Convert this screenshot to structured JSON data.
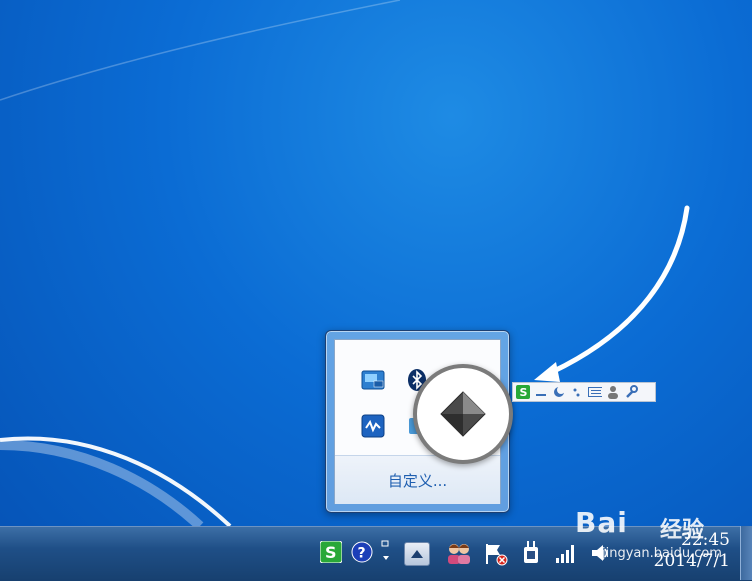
{
  "flyout": {
    "customize_label": "自定义...",
    "icons": [
      "intel-graphics-icon",
      "bluetooth-icon",
      "pink-app-icon",
      "network-app-icon",
      "blue-app-icon"
    ]
  },
  "magnifier": {
    "icon": "gray-diamond-app-icon"
  },
  "ime_toolbar": {
    "icons": [
      "sogou-s-icon",
      "fullwidth-icon",
      "moon-icon",
      "punctuation-icon",
      "keyboard-icon",
      "user-icon",
      "wrench-icon"
    ]
  },
  "taskbar": {
    "tray_icons": [
      "sogou-s-icon",
      "help-icon",
      "ime-mode-icon",
      "show-hidden-icons-button",
      "people-icon",
      "action-center-flag-icon",
      "power-plug-icon",
      "signal-bars-icon",
      "speaker-icon"
    ],
    "clock": {
      "time": "22:45",
      "date": "2014/7/1"
    }
  },
  "watermark": {
    "brand": "Bai",
    "brand_cn": "经验",
    "url": "jingyan.baidu.com"
  },
  "colors": {
    "desktop": "#0b6cd4",
    "taskbar": "#1f4f87",
    "accent_green": "#29a838",
    "link": "#1f5fb0"
  }
}
